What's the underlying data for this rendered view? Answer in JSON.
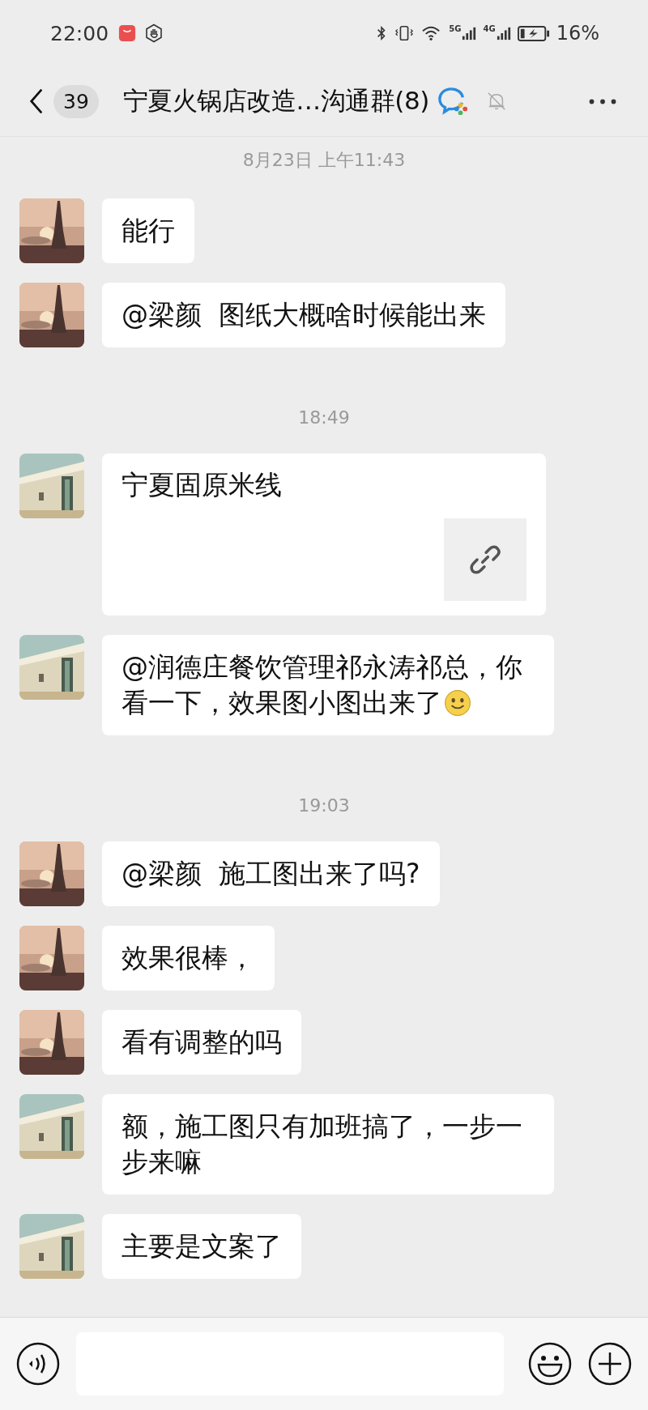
{
  "status_bar": {
    "time": "22:00",
    "networks": [
      {
        "label": "5G"
      },
      {
        "label": "4G"
      }
    ],
    "battery": "16%"
  },
  "header": {
    "unread": "39",
    "title": "宁夏火锅店改造…沟通群(8)",
    "muted": true
  },
  "messages": [
    {
      "kind": "time",
      "text": "8月23日 上午11:43"
    },
    {
      "kind": "text",
      "text": "能行"
    },
    {
      "kind": "text",
      "text": "@梁颜  图纸大概啥时候能出来"
    },
    {
      "kind": "time",
      "text": "18:49"
    },
    {
      "kind": "link",
      "text": "宁夏固原米线"
    },
    {
      "kind": "text",
      "text": "@润德庄餐饮管理祁永涛祁总，你看一下，效果图小图出来了",
      "emoji": true
    },
    {
      "kind": "time",
      "text": "19:03"
    },
    {
      "kind": "text",
      "text": "@梁颜  施工图出来了吗?"
    },
    {
      "kind": "text",
      "text": "效果很棒，"
    },
    {
      "kind": "text",
      "text": "看有调整的吗"
    },
    {
      "kind": "text",
      "text": "额，施工图只有加班搞了，一步一步来嘛"
    },
    {
      "kind": "text",
      "text": "主要是文案了"
    }
  ]
}
